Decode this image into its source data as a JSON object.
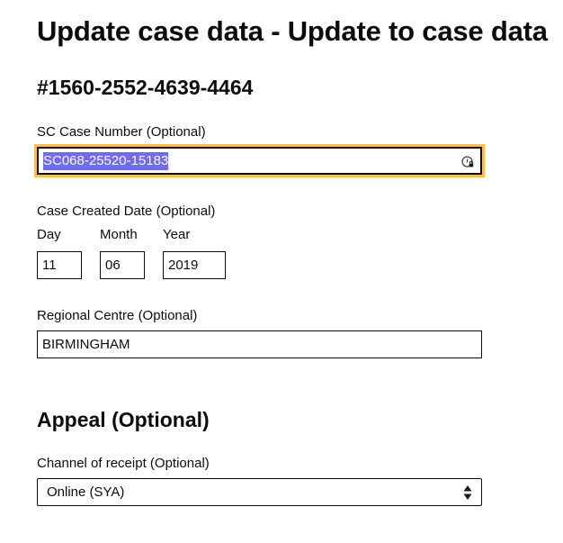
{
  "page_title": "Update case data - Update to case data",
  "case_reference": "#1560-2552-4639-4464",
  "sc_case_number": {
    "label": "SC Case Number (Optional)",
    "value": "SC068-25520-15183"
  },
  "case_created_date": {
    "label": "Case Created Date (Optional)",
    "day_label": "Day",
    "month_label": "Month",
    "year_label": "Year",
    "day_value": "11",
    "month_value": "06",
    "year_value": "2019"
  },
  "regional_centre": {
    "label": "Regional Centre (Optional)",
    "value": "BIRMINGHAM"
  },
  "appeal": {
    "heading": "Appeal (Optional)",
    "channel_label": "Channel of receipt (Optional)",
    "channel_value": "Online (SYA)"
  },
  "colors": {
    "focus": "#ffbf47",
    "selection": "#6f6af8",
    "text": "#0b0c0c"
  },
  "icons": {
    "password_manager": "password-manager-icon",
    "select_arrows": "select-arrows-icon"
  }
}
